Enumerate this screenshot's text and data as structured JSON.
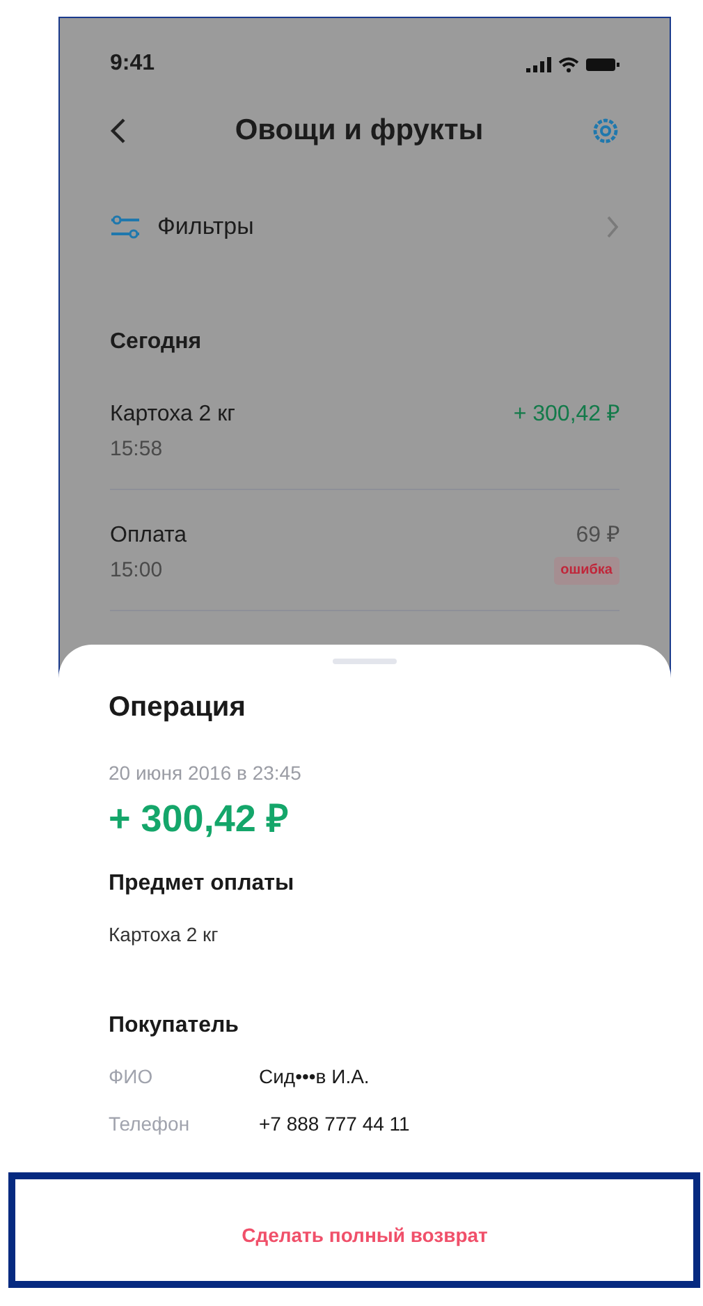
{
  "status_bar": {
    "time": "9:41"
  },
  "header": {
    "title": "Овощи и фрукты"
  },
  "filters": {
    "label": "Фильтры"
  },
  "section": {
    "title": "Сегодня"
  },
  "operations": [
    {
      "name": "Картоха 2 кг",
      "time": "15:58",
      "amount": "+ 300,42 ₽",
      "kind": "income"
    },
    {
      "name": "Оплата",
      "time": "15:00",
      "amount": "69 ₽",
      "kind": "plain",
      "badge": "ошибка"
    }
  ],
  "sheet": {
    "title": "Операция",
    "date": "20 июня 2016 в 23:45",
    "amount": "+ 300,42 ₽",
    "subject": {
      "heading": "Предмет оплаты",
      "value": "Картоха 2 кг"
    },
    "buyer": {
      "heading": "Покупатель",
      "fields": [
        {
          "label": "ФИО",
          "value": "Сид•••в И.А."
        },
        {
          "label": "Телефон",
          "value": "+7 888 777 44 11"
        }
      ]
    },
    "action": {
      "label": "Сделать полный возврат",
      "highlighted": true
    }
  }
}
